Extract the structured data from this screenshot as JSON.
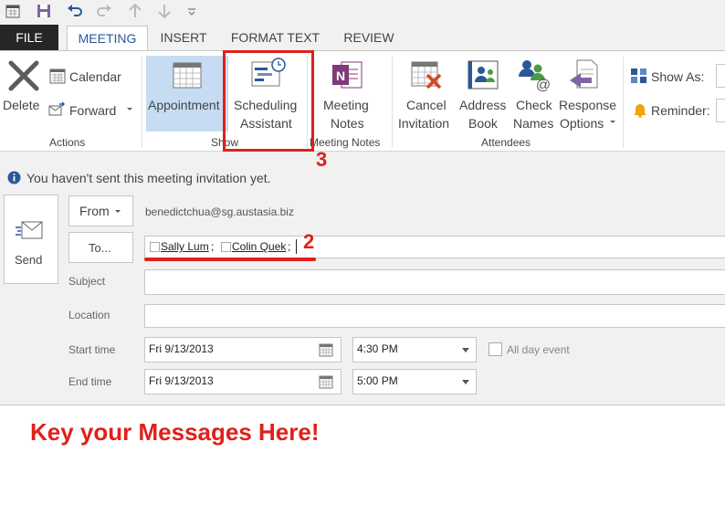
{
  "tabs": [
    {
      "label": "FILE"
    },
    {
      "label": "MEETING"
    },
    {
      "label": "INSERT"
    },
    {
      "label": "FORMAT TEXT"
    },
    {
      "label": "REVIEW"
    }
  ],
  "ribbon": {
    "actions": {
      "delete": "Delete",
      "calendar": "Calendar",
      "forward": "Forward",
      "group": "Actions"
    },
    "show": {
      "appointment": "Appointment",
      "scheduling_line1": "Scheduling",
      "scheduling_line2": "Assistant",
      "group": "Show"
    },
    "meeting_notes": {
      "line1": "Meeting",
      "line2": "Notes",
      "group": "Meeting Notes"
    },
    "attendees": {
      "cancel_line1": "Cancel",
      "cancel_line2": "Invitation",
      "address_line1": "Address",
      "address_line2": "Book",
      "check_line1": "Check",
      "check_line2": "Names",
      "response_line1": "Response",
      "response_line2": "Options",
      "group": "Attendees"
    },
    "options": {
      "show_as": "Show As:",
      "reminder": "Reminder:"
    }
  },
  "info_bar": "You haven't sent this meeting invitation yet.",
  "form": {
    "send": "Send",
    "from_button": "From",
    "from_value": "benedictchua@sg.austasia.biz",
    "to_button": "To...",
    "recipients": [
      {
        "name": "Sally Lum",
        "sep": ";"
      },
      {
        "name": "Colin Quek",
        "sep": ";"
      }
    ],
    "subject_label": "Subject",
    "subject_value": "",
    "location_label": "Location",
    "location_value": "",
    "start_label": "Start time",
    "start_date": "Fri 9/13/2013",
    "start_time": "4:30 PM",
    "all_day": "All day event",
    "end_label": "End time",
    "end_date": "Fri 9/13/2013",
    "end_time": "5:00 PM"
  },
  "annotations": {
    "step3": "3",
    "step2": "2",
    "message": "Key your Messages Here!"
  },
  "colors": {
    "accent": "#2b579a",
    "annotation": "#e0201b",
    "selected": "#c5dcf2"
  }
}
